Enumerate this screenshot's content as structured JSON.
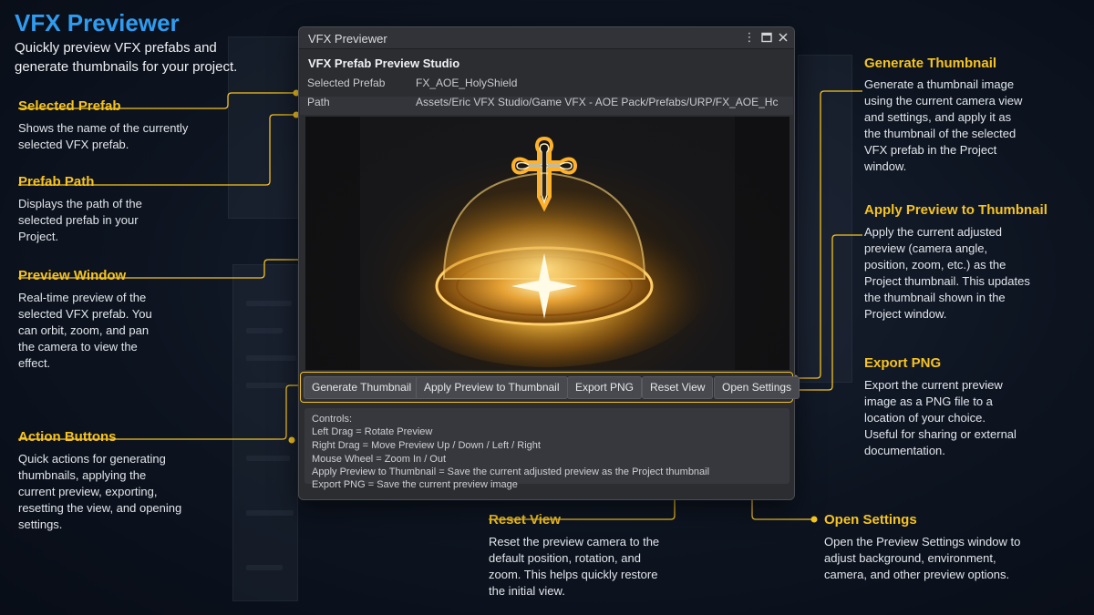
{
  "hero": {
    "title": "VFX Previewer",
    "subtitle": "Quickly preview VFX prefabs and generate thumbnails for your project."
  },
  "annotations": {
    "selected_prefab": {
      "title": "Selected Prefab",
      "text": "Shows the name of the currently selected VFX prefab."
    },
    "prefab_path": {
      "title": "Prefab Path",
      "text": "Displays the path of the selected prefab in your Project."
    },
    "preview_window": {
      "title": "Preview Window",
      "text": "Real-time preview of the selected VFX prefab. You can orbit, zoom, and pan the camera to view the effect."
    },
    "action_buttons": {
      "title": "Action Buttons",
      "text": "Quick actions for generating thumbnails, applying the current preview, exporting, resetting the view, and opening settings."
    },
    "generate_thumbnail": {
      "title": "Generate Thumbnail",
      "text": "Generate a thumbnail image using the current camera view and settings, and apply it as the thumbnail of the selected VFX prefab in the Project window."
    },
    "apply_preview": {
      "title": "Apply Preview to Thumbnail",
      "text": "Apply the current adjusted preview (camera angle, position, zoom, etc.) as the Project thumbnail. This updates the thumbnail shown in the Project window."
    },
    "export_png": {
      "title": "Export PNG",
      "text": "Export the current preview image as a PNG file to a location of your choice. Useful for sharing or external documentation."
    },
    "reset_view": {
      "title": "Reset View",
      "text": "Reset the preview camera to the default position, rotation, and zoom. This helps quickly restore the initial view."
    },
    "open_settings": {
      "title": "Open Settings",
      "text": "Open the Preview Settings window to adjust background, environment, camera, and other preview options."
    }
  },
  "window": {
    "title": "VFX Previewer",
    "icons": [
      "kebab-menu-icon",
      "maximize-icon",
      "close-icon"
    ],
    "studio_title": "VFX Prefab Preview Studio",
    "selected_prefab_label": "Selected Prefab",
    "selected_prefab_value": "FX_AOE_HolyShield",
    "path_label": "Path",
    "path_value": "Assets/Eric VFX Studio/Game VFX - AOE Pack/Prefabs/URP/FX_AOE_Hc"
  },
  "buttons": {
    "generate": "Generate Thumbnail",
    "apply": "Apply Preview to Thumbnail",
    "export": "Export PNG",
    "reset": "Reset View",
    "settings": "Open Settings"
  },
  "controls": {
    "heading": "Controls:",
    "lines": [
      "Left Drag = Rotate Preview",
      "Right Drag = Move Preview Up / Down / Left / Right",
      "Mouse Wheel = Zoom In / Out",
      "Apply Preview to Thumbnail = Save the current adjusted preview as the Project thumbnail",
      "Export PNG = Save the current preview image"
    ]
  },
  "colors": {
    "accent": "#f6c320",
    "title_blue": "#2f9cf0",
    "background": "#0b1220"
  }
}
